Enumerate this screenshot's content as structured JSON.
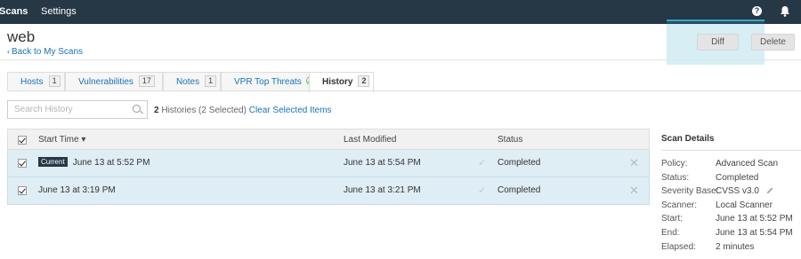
{
  "nav": {
    "scans": "Scans",
    "settings": "Settings"
  },
  "icons": {
    "help": "help-icon",
    "bell": "bell-icon",
    "back": "chevron-left-icon",
    "search": "search-icon",
    "threats_ok": "check-circle-icon",
    "remove": "close-icon",
    "edit": "pencil-icon"
  },
  "page": {
    "title": "web",
    "back_label": "Back to My Scans"
  },
  "toolbar": {
    "diff_label": "Diff",
    "delete_label": "Delete"
  },
  "tabs": [
    {
      "label": "Hosts",
      "count": "1"
    },
    {
      "label": "Vulnerabilities",
      "count": "17"
    },
    {
      "label": "Notes",
      "count": "1"
    },
    {
      "label": "VPR Top Threats"
    },
    {
      "label": "History",
      "count": "2",
      "active": true
    }
  ],
  "search": {
    "placeholder": "Search History",
    "value": ""
  },
  "history_summary": {
    "count": "2",
    "text_a": "Histories (",
    "selected": "2",
    "text_b": "Selected)",
    "clear_label": "Clear Selected Items"
  },
  "table": {
    "headers": {
      "start": "Start Time ▾",
      "modified": "Last Modified",
      "status": "Status"
    },
    "rows": [
      {
        "current_tag": "Current",
        "start": "June 13 at 5:52 PM",
        "modified": "June 13 at 5:54 PM",
        "status": "Completed",
        "checked": true
      },
      {
        "start": "June 13 at 3:19 PM",
        "modified": "June 13 at 3:21 PM",
        "status": "Completed",
        "checked": true
      }
    ]
  },
  "details": {
    "title": "Scan Details",
    "rows": [
      {
        "key": "Policy:",
        "value": "Advanced Scan"
      },
      {
        "key": "Status:",
        "value": "Completed"
      },
      {
        "key": "Severity Base:",
        "value": "CVSS v3.0"
      },
      {
        "key": "Scanner:",
        "value": "Local Scanner"
      },
      {
        "key": "Start:",
        "value": "June 13 at 5:52 PM"
      },
      {
        "key": "End:",
        "value": "June 13 at 5:54 PM"
      },
      {
        "key": "Elapsed:",
        "value": "2 minutes"
      }
    ]
  },
  "colors": {
    "topbar": "#263746",
    "link": "#1a73b5",
    "row_selected": "#dfedf5",
    "ok": "#6bbf59"
  }
}
